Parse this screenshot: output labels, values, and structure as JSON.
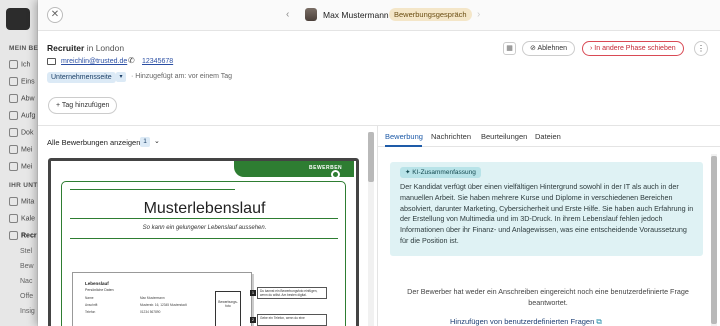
{
  "sidebar": {
    "sections": [
      {
        "heading": "MEIN BE",
        "items": [
          "Ich",
          "Eins",
          "Abw",
          "Aufg",
          "Dok",
          "Mei",
          "Mei"
        ]
      },
      {
        "heading": "IHR UNTI",
        "items": [
          "Mita",
          "Kale",
          "Recr",
          "Stel",
          "Bew",
          "Nac",
          "Offe",
          "Insig"
        ]
      }
    ]
  },
  "topbar": {
    "close_icon": "✕",
    "prev_icon": "‹",
    "next_icon": "›",
    "candidate_name": "Max Mustermann",
    "stage": "Bewerbungsgespräch"
  },
  "header": {
    "role": "Recruiter",
    "location_prefix": "in",
    "location": "London",
    "email": "mreichlin@trusted.de",
    "phone": "12345678",
    "source": "Unternehmensseite",
    "added_info": "Hinzugefügt am: vor einem Tag",
    "add_tag_label": "Tag hinzufügen",
    "reject_label": "Ablehnen",
    "move_label": "In andere Phase schieben",
    "more_icon": "⋮"
  },
  "left_pane": {
    "show_all_label": "Alle Bewerbungen anzeigen",
    "application_count": "1"
  },
  "cv_preview": {
    "apply_banner": "BEWERBEN",
    "title": "Musterlebenslauf",
    "subtitle": "So kann ein gelungener Lebenslauf aussehen.",
    "doc_title": "Lebenslauf",
    "doc_section": "Persönliche Daten",
    "doc_rows": [
      {
        "label": "Name",
        "value": "Max Mustermann"
      },
      {
        "label": "Anschrift",
        "value": "Musterstr. 16, 12345 Musterstadt"
      },
      {
        "label": "Telefon",
        "value": "01234 567890"
      }
    ],
    "photo_label": "Bewerbungs-foto",
    "notes": [
      {
        "num": "1",
        "text": "Du kannst ein Bewerbungsfoto einfügen, wenn du willst. Am besten digital."
      },
      {
        "num": "2",
        "text": "Gebe ein Telefon, wenn du eine"
      }
    ]
  },
  "right_pane": {
    "tabs": [
      "Bewerbung",
      "Nachrichten",
      "Beurteilungen",
      "Dateien"
    ],
    "active_tab": "Bewerbung",
    "ai_badge": "KI-Zusammenfassung",
    "ai_summary": "Der Kandidat verfügt über einen vielfältigen Hintergrund sowohl in der IT als auch in der manuellen Arbeit. Sie haben mehrere Kurse und Diplome in verschiedenen Bereichen absolviert, darunter Marketing, Cybersicherheit und Erste Hilfe. Sie haben auch Erfahrung in der Erstellung von Multimedia und im 3D-Druck. In ihrem Lebenslauf fehlen jedoch Informationen über ihr Finanz- und Anlagewissen, was eine entscheidende Voraussetzung für die Position ist.",
    "no_answer_text": "Der Bewerber hat weder ein Anschreiben eingereicht noch eine benutzerdefinierte Frage beantwortet.",
    "add_question_label": "Hinzufügen von benutzerdefinierten Fragen"
  },
  "colors": {
    "accent_blue": "#1e5ba8",
    "reject_red": "#c52b38",
    "ai_card_bg": "#dff2f4",
    "cv_green": "#2e7d32",
    "stage_badge_bg": "#f4e6c8"
  }
}
